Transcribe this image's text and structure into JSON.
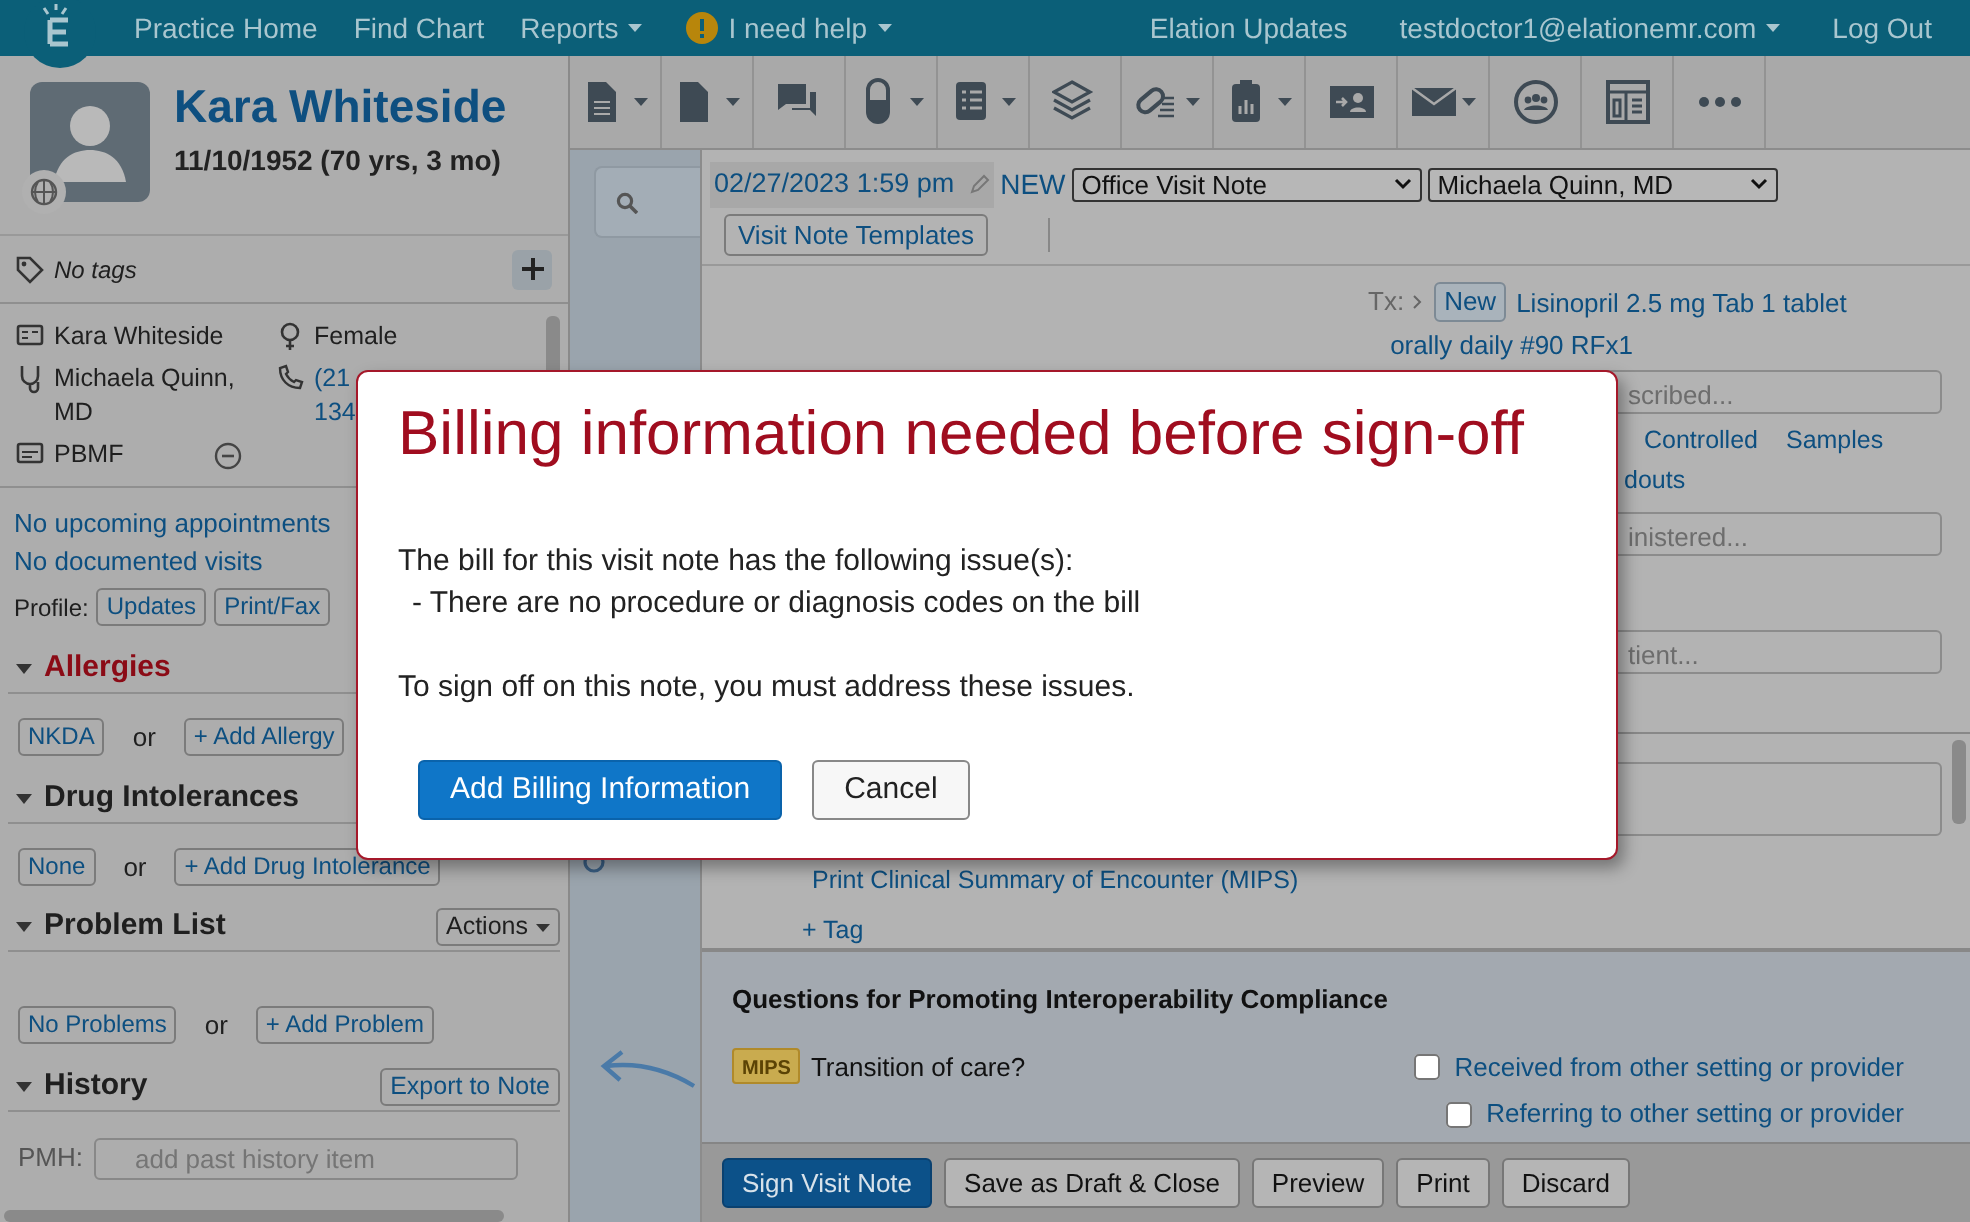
{
  "nav": {
    "left": [
      {
        "label": "Practice Home",
        "caret": false,
        "alert": false
      },
      {
        "label": "Find Chart",
        "caret": false,
        "alert": false
      },
      {
        "label": "Reports",
        "caret": true,
        "alert": false
      },
      {
        "label": "I need help",
        "caret": true,
        "alert": true
      }
    ],
    "right": [
      {
        "label": "Elation Updates",
        "caret": false
      },
      {
        "label": "testdoctor1@elationemr.com",
        "caret": true
      },
      {
        "label": "Log Out",
        "caret": false
      }
    ]
  },
  "patient": {
    "name": "Kara Whiteside",
    "dob": "11/10/1952 (70 yrs, 3 mo)",
    "tags": "No tags",
    "details_left": [
      {
        "kind": "id",
        "lines": [
          "Kara Whiteside"
        ],
        "removable": false
      },
      {
        "kind": "doctor",
        "lines": [
          "Michaela Quinn,",
          "MD"
        ],
        "removable": false
      },
      {
        "kind": "insurance",
        "lines": [
          "PBMF"
        ],
        "removable": true
      }
    ],
    "details_right": [
      {
        "kind": "gender",
        "lines": [
          "Female"
        ],
        "link": false
      },
      {
        "kind": "phone",
        "lines": [
          "(21",
          "134"
        ],
        "link": true
      }
    ],
    "links": [
      "No upcoming appointments",
      "No documented visits"
    ],
    "profile": {
      "label": "Profile:",
      "buttons": [
        "Updates",
        "Print/Fax"
      ]
    },
    "sections": [
      {
        "title": "Allergies",
        "alert": true,
        "options": [
          "NKDA"
        ],
        "or": "or",
        "add": "+ Add Allergy"
      },
      {
        "title": "Drug Intolerances",
        "alert": false,
        "options": [
          "None"
        ],
        "or": "or",
        "add": "+ Add Drug Intolerance"
      },
      {
        "title": "Problem List",
        "alert": false,
        "action": {
          "label": "Actions",
          "caret": true
        },
        "options": [
          "No Problems"
        ],
        "or": "or",
        "add": "+ Add Problem"
      },
      {
        "title": "History",
        "alert": false,
        "action": {
          "label": "Export to Note",
          "caret": false
        },
        "field": {
          "label": "PMH:",
          "placeholder": "add past history item"
        }
      }
    ]
  },
  "toolbar": [
    {
      "caret": true
    },
    {
      "caret": true
    },
    {
      "caret": false
    },
    {
      "caret": true
    },
    {
      "caret": true
    },
    {
      "caret": false
    },
    {
      "caret": true
    },
    {
      "caret": true
    },
    {
      "caret": false
    },
    {
      "caret": true
    },
    {
      "caret": false
    },
    {
      "caret": false
    },
    {
      "caret": false
    }
  ],
  "note": {
    "datetime": "02/27/2023 1:59 pm",
    "status": "NEW",
    "type": "Office Visit Note",
    "provider": "Michaela Quinn, MD",
    "templates": "Visit Note Templates",
    "tx": {
      "label": "Tx:",
      "badge": "New",
      "lines": [
        "Lisinopril 2.5 mg Tab 1 tablet",
        "orally daily #90 RFx1"
      ]
    },
    "field_1": "scribed...",
    "links_row": [
      "Controlled",
      "Samples"
    ],
    "links_row_2": "douts",
    "field_2": "inistered...",
    "field_3": "tient...",
    "summary_link": "Print Clinical Summary of Encounter (MIPS)",
    "tag_link": "+ Tag",
    "questions": {
      "title": "Questions for Promoting Interoperability Compliance",
      "badge": "MIPS",
      "question": "Transition of care?",
      "options": [
        {
          "label": "Received from other setting or provider",
          "checked": false
        },
        {
          "label": "Referring to other setting or provider",
          "checked": false
        }
      ]
    },
    "actions": [
      {
        "label": "Sign Visit Note",
        "primary": true
      },
      {
        "label": "Save as Draft & Close",
        "primary": false
      },
      {
        "label": "Preview",
        "primary": false
      },
      {
        "label": "Print",
        "primary": false
      },
      {
        "label": "Discard",
        "primary": false
      }
    ]
  },
  "modal": {
    "title": "Billing information needed before sign-off",
    "intro": "The bill for this visit note has the following issue(s):",
    "issues": [
      "- There are no procedure or diagnosis codes on the bill"
    ],
    "footer_text": "To sign off on this note, you must address these issues.",
    "buttons": [
      {
        "label": "Add Billing Information",
        "primary": true
      },
      {
        "label": "Cancel",
        "primary": false
      }
    ]
  }
}
